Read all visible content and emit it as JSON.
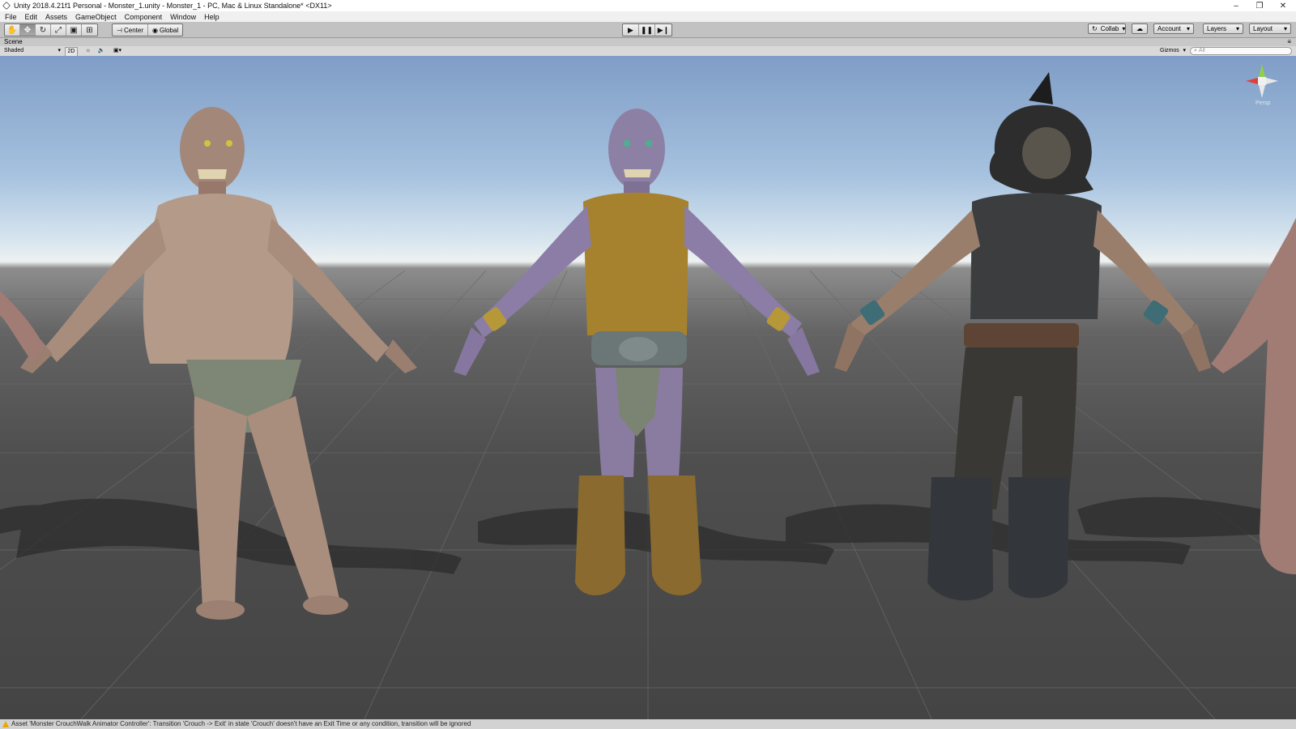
{
  "window": {
    "title": "Unity 2018.4.21f1 Personal - Monster_1.unity - Monster_1 - PC, Mac & Linux Standalone* <DX11>"
  },
  "menu": [
    "File",
    "Edit",
    "Assets",
    "GameObject",
    "Component",
    "Window",
    "Help"
  ],
  "toolbar": {
    "transform_tools": [
      {
        "name": "hand-tool-icon",
        "glyph": "✋"
      },
      {
        "name": "move-tool-icon",
        "glyph": "✥"
      },
      {
        "name": "rotate-tool-icon",
        "glyph": "↻"
      },
      {
        "name": "scale-tool-icon",
        "glyph": "⤢"
      },
      {
        "name": "rect-tool-icon",
        "glyph": "▣"
      },
      {
        "name": "transform-tool-icon",
        "glyph": "⊞"
      }
    ],
    "active_tool": "move-tool-icon",
    "pivot": "Center",
    "space": "Global",
    "collab": "Collab",
    "account": "Account",
    "layers": "Layers",
    "layout": "Layout"
  },
  "scene_tab": {
    "label": "Scene",
    "shading_mode": "Shaded",
    "mode_2d": "2D",
    "gizmos": "Gizmos",
    "search_placeholder": "All"
  },
  "viewport": {
    "gizmo_label": "Persp"
  },
  "status": {
    "message": "Asset 'Monster CrouchWalk Animator Controller': Transition 'Crouch -> Exit' in state 'Crouch' doesn't have an Exit Time or any condition, transition will be ignored"
  },
  "colors": {
    "toolbar_bg": "#c2c2c2",
    "sky_top": "#7f9dc6",
    "ground": "#4f4f4f",
    "warning": "#e9a700"
  }
}
